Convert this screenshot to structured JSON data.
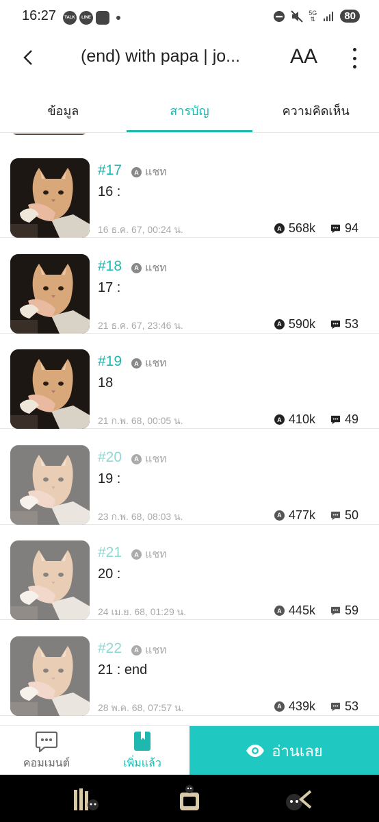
{
  "status": {
    "time": "16:27",
    "apps": [
      "TALK",
      "LINE"
    ],
    "network": "5G",
    "battery": "80"
  },
  "header": {
    "title": "(end) with papa | jo...",
    "font_button": "AA"
  },
  "tabs": [
    {
      "label": "ข้อมูล",
      "active": false
    },
    {
      "label": "สารบัญ",
      "active": true
    },
    {
      "label": "ความคิดเห็น",
      "active": false
    }
  ],
  "colors": {
    "accent": "#1fb8b0",
    "read_button": "#1fc9c2"
  },
  "episodes": [
    {
      "number": "#17",
      "tag": "แชท",
      "title": "16 :",
      "date": "16 ธ.ค. 67, 00:24 น.",
      "views": "568k",
      "comments": "94",
      "read": false
    },
    {
      "number": "#18",
      "tag": "แชท",
      "title": "17 :",
      "date": "21 ธ.ค. 67, 23:46 น.",
      "views": "590k",
      "comments": "53",
      "read": false
    },
    {
      "number": "#19",
      "tag": "แชท",
      "title": "18",
      "date": "21 ก.พ. 68, 00:05 น.",
      "views": "410k",
      "comments": "49",
      "read": false
    },
    {
      "number": "#20",
      "tag": "แชท",
      "title": "19 :",
      "date": "23 ก.พ. 68, 08:03 น.",
      "views": "477k",
      "comments": "50",
      "read": true
    },
    {
      "number": "#21",
      "tag": "แชท",
      "title": "20 :",
      "date": "24 เม.ย. 68, 01:29 น.",
      "views": "445k",
      "comments": "59",
      "read": true
    },
    {
      "number": "#22",
      "tag": "แชท",
      "title": "21 : end",
      "date": "28 พ.ค. 68, 07:57 น.",
      "views": "439k",
      "comments": "53",
      "read": true
    }
  ],
  "bottom": {
    "comment_label": "คอมเมนต์",
    "added_label": "เพิ่มแล้ว",
    "read_label": "อ่านเลย"
  },
  "nav_icons": [
    "library-icon",
    "home-icon",
    "profile-icon"
  ]
}
